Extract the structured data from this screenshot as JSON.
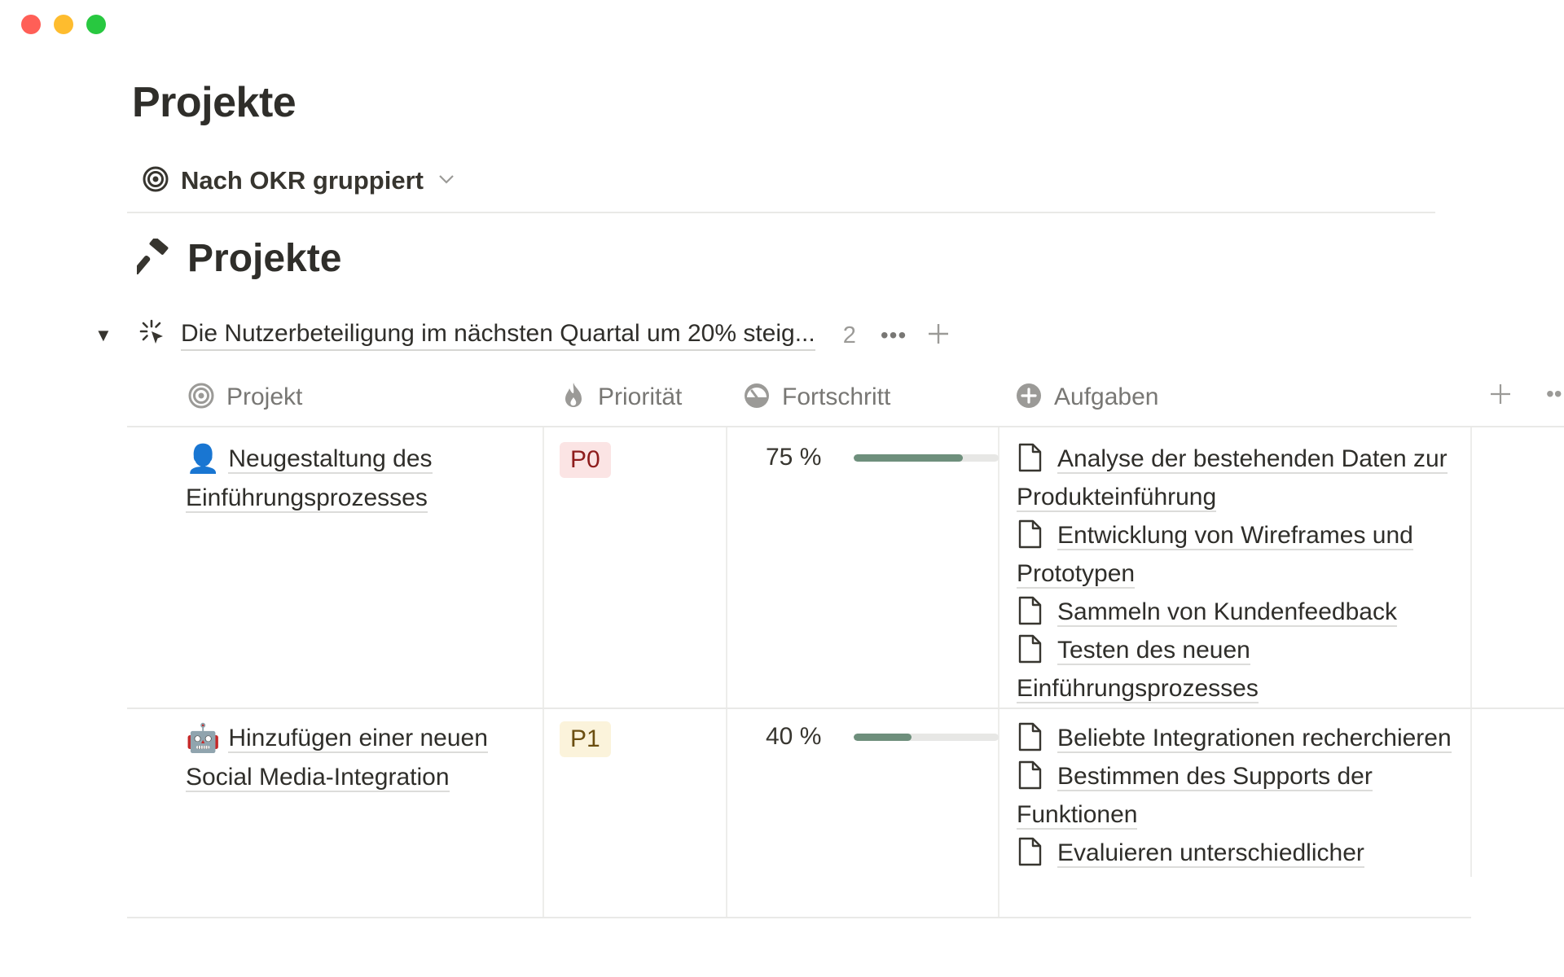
{
  "window": {
    "controls": [
      "close",
      "minimize",
      "zoom"
    ]
  },
  "page_title": "Projekte",
  "view": {
    "label": "Nach OKR gruppiert",
    "icon": "target-icon"
  },
  "database": {
    "title": "Projekte",
    "icon": "hammer-icon"
  },
  "group": {
    "name": "Die Nutzerbeteiligung im nächsten Quartal um 20% steig...",
    "count": "2",
    "more": "•••",
    "icon": "sparkle-cursor-icon"
  },
  "columns": [
    {
      "label": "Projekt",
      "icon": "target-icon"
    },
    {
      "label": "Priorität",
      "icon": "fire-icon"
    },
    {
      "label": "Fortschritt",
      "icon": "gauge-icon"
    },
    {
      "label": "Aufgaben",
      "icon": "plus-circle-icon"
    }
  ],
  "rows": [
    {
      "emoji": "👤",
      "project": "Neugestaltung des Einführungsprozesses",
      "priority": "P0",
      "priority_bg": "#fbe4e4",
      "priority_color": "#8e1d1d",
      "progress_label": "75 %",
      "progress_value": 0.75,
      "tasks": [
        "Analyse der bestehenden Daten zur Produkteinführung",
        "Entwicklung von Wireframes und Prototypen",
        "Sammeln von Kundenfeedback",
        "Testen des neuen Einführungsprozesses"
      ]
    },
    {
      "emoji": "🤖",
      "project": "Hinzufügen einer neuen Social Media-Integration",
      "priority": "P1",
      "priority_bg": "#fbf3db",
      "priority_color": "#6b4e10",
      "progress_label": "40 %",
      "progress_value": 0.4,
      "tasks": [
        "Beliebte Integrationen recherchieren",
        "Bestimmen des Supports der Funktionen",
        "Evaluieren unterschiedlicher"
      ]
    }
  ],
  "header_actions": {
    "more": "••"
  },
  "colors": {
    "progress_fill": "#6e8f7c",
    "progress_track": "#e7e7e5"
  }
}
